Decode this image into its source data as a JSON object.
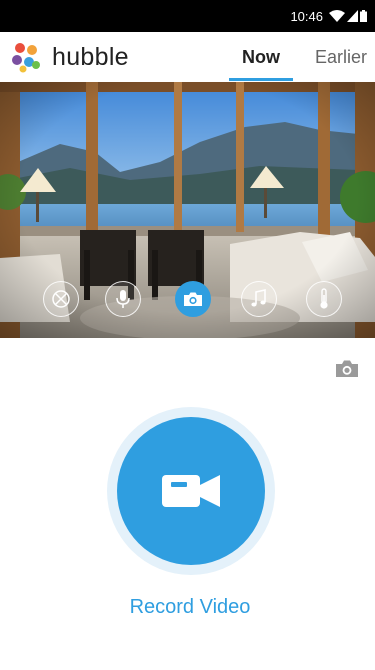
{
  "status_bar": {
    "time": "10:46",
    "icons": [
      "wifi-icon",
      "signal-icon",
      "battery-icon"
    ]
  },
  "header": {
    "brand_name": "hubble",
    "tabs": [
      {
        "label": "Now",
        "active": true
      },
      {
        "label": "Earlier",
        "active": false
      }
    ]
  },
  "camera_controls": [
    {
      "icon": "pan-tilt-icon",
      "active": false
    },
    {
      "icon": "microphone-icon",
      "active": false
    },
    {
      "icon": "camera-icon",
      "active": true
    },
    {
      "icon": "music-note-icon",
      "active": false
    },
    {
      "icon": "thermometer-icon",
      "active": false
    }
  ],
  "record": {
    "label": "Record Video",
    "icon": "video-camera-icon"
  },
  "colors": {
    "accent": "#2f9ee0",
    "halo": "#e4f1fa"
  }
}
